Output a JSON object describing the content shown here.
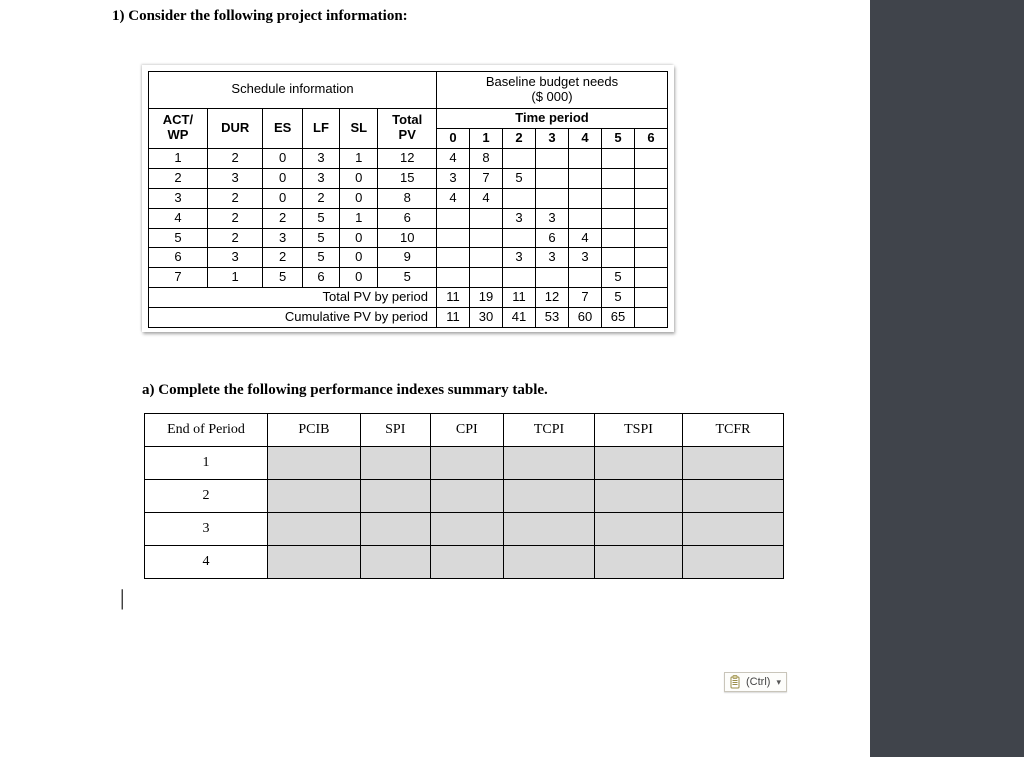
{
  "question_heading": "1)   Consider the following project information:",
  "subquestion_heading": "a)   Complete the following performance indexes summary table.",
  "paste_tag": {
    "label": "(Ctrl)"
  },
  "schedule": {
    "section_left": "Schedule information",
    "section_right_line1": "Baseline budget needs",
    "section_right_line2": "($ 000)",
    "col_act_wp_line1": "ACT/",
    "col_act_wp_line2": "WP",
    "col_dur": "DUR",
    "col_es": "ES",
    "col_lf": "LF",
    "col_sl": "SL",
    "col_total_pv_line1": "Total",
    "col_total_pv_line2": "PV",
    "col_time_period": "Time period",
    "period_labels": [
      "0",
      "1",
      "2",
      "3",
      "4",
      "5",
      "6"
    ],
    "rows": [
      {
        "id": "1",
        "dur": "2",
        "es": "0",
        "lf": "3",
        "sl": "1",
        "tpv": "12",
        "p": [
          "4",
          "8",
          "",
          "",
          "",
          "",
          ""
        ]
      },
      {
        "id": "2",
        "dur": "3",
        "es": "0",
        "lf": "3",
        "sl": "0",
        "tpv": "15",
        "p": [
          "3",
          "7",
          "5",
          "",
          "",
          "",
          ""
        ]
      },
      {
        "id": "3",
        "dur": "2",
        "es": "0",
        "lf": "2",
        "sl": "0",
        "tpv": "8",
        "p": [
          "4",
          "4",
          "",
          "",
          "",
          "",
          ""
        ]
      },
      {
        "id": "4",
        "dur": "2",
        "es": "2",
        "lf": "5",
        "sl": "1",
        "tpv": "6",
        "p": [
          "",
          "",
          "3",
          "3",
          "",
          "",
          ""
        ]
      },
      {
        "id": "5",
        "dur": "2",
        "es": "3",
        "lf": "5",
        "sl": "0",
        "tpv": "10",
        "p": [
          "",
          "",
          "",
          "6",
          "4",
          "",
          ""
        ]
      },
      {
        "id": "6",
        "dur": "3",
        "es": "2",
        "lf": "5",
        "sl": "0",
        "tpv": "9",
        "p": [
          "",
          "",
          "3",
          "3",
          "3",
          "",
          ""
        ]
      },
      {
        "id": "7",
        "dur": "1",
        "es": "5",
        "lf": "6",
        "sl": "0",
        "tpv": "5",
        "p": [
          "",
          "",
          "",
          "",
          "",
          "5",
          ""
        ]
      }
    ],
    "total_row_label": "Total PV by period",
    "total_row": [
      "11",
      "19",
      "11",
      "12",
      "7",
      "5"
    ],
    "cum_row_label": "Cumulative PV by period",
    "cum_row": [
      "11",
      "30",
      "41",
      "53",
      "60",
      "65"
    ]
  },
  "perf_table": {
    "headers": [
      "End of Period",
      "PCIB",
      "SPI",
      "CPI",
      "TCPI",
      "TSPI",
      "TCFR"
    ],
    "rows": [
      "1",
      "2",
      "3",
      "4"
    ]
  }
}
